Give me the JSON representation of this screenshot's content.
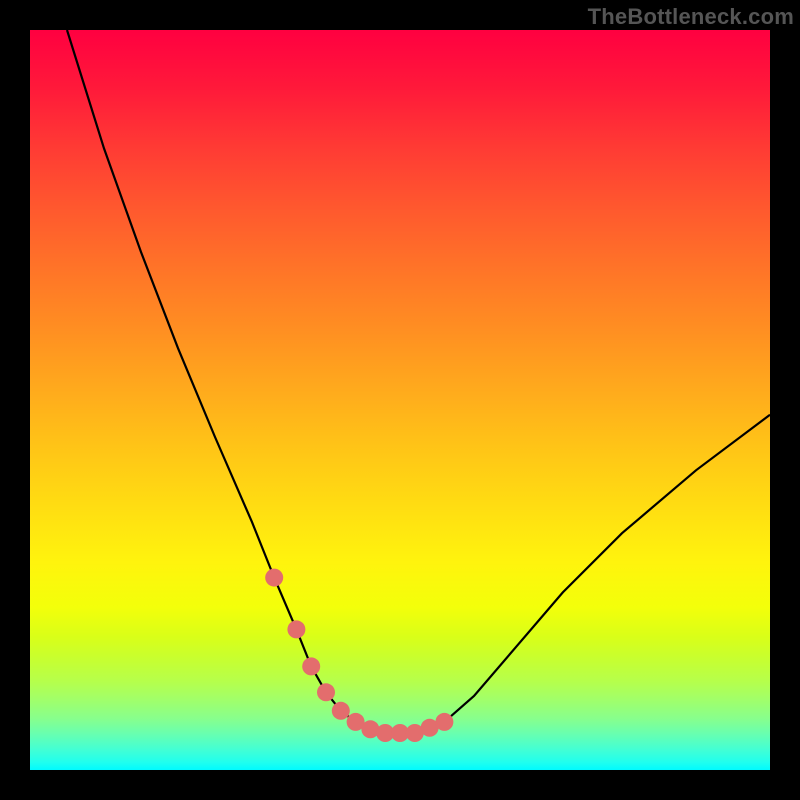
{
  "watermark": "TheBottleneck.com",
  "chart_data": {
    "type": "line",
    "title": "",
    "xlabel": "",
    "ylabel": "",
    "xlim": [
      0,
      100
    ],
    "ylim": [
      0,
      100
    ],
    "series": [
      {
        "name": "curve",
        "x": [
          5,
          10,
          15,
          20,
          25,
          30,
          33,
          36,
          38,
          40,
          42,
          44,
          46,
          48,
          52,
          56,
          60,
          66,
          72,
          80,
          90,
          100
        ],
        "values": [
          100,
          84,
          70,
          57,
          45,
          33.5,
          26,
          19,
          14,
          10.5,
          8,
          6.5,
          5.5,
          5,
          5,
          6.5,
          10,
          17,
          24,
          32,
          40.5,
          48
        ]
      },
      {
        "name": "markers",
        "x": [
          33,
          36,
          38,
          40,
          42,
          44,
          46,
          48,
          50,
          52,
          54,
          56
        ],
        "values": [
          26,
          19,
          14,
          10.5,
          8,
          6.5,
          5.5,
          5,
          5,
          5,
          5.7,
          6.5
        ]
      }
    ],
    "marker_color": "#e36d6d",
    "curve_color": "#000000"
  }
}
